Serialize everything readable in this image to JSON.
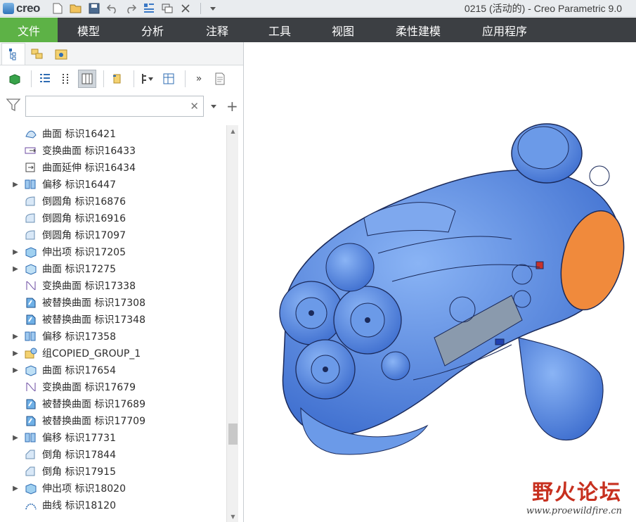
{
  "app": {
    "logo_text": "creo",
    "window_title": "0215 (活动的) - Creo Parametric 9.0"
  },
  "quick_access": [
    "new-icon",
    "open-icon",
    "save-icon",
    "undo-icon",
    "redo-icon",
    "regenerate-icon",
    "windows-icon",
    "close-icon",
    "customize-icon"
  ],
  "ribbon": {
    "tabs": [
      "文件",
      "模型",
      "分析",
      "注释",
      "工具",
      "视图",
      "柔性建模",
      "应用程序"
    ],
    "active_index": 0,
    "colors": {
      "bar": "#3c3f43",
      "active": "#5db246"
    }
  },
  "navigator": {
    "tabs": [
      "model-tree-icon",
      "layer-tree-icon",
      "favorites-icon"
    ],
    "filter": {
      "value": "",
      "placeholder": ""
    },
    "tree_items": [
      {
        "label": "曲面 标识16421",
        "icon": "surface-icon",
        "expandable": false
      },
      {
        "label": "变换曲面 标识16433",
        "icon": "transform-surface-icon",
        "expandable": false
      },
      {
        "label": "曲面延伸 标识16434",
        "icon": "surface-extend-icon",
        "expandable": false
      },
      {
        "label": "偏移 标识16447",
        "icon": "offset-icon",
        "expandable": true
      },
      {
        "label": "倒圆角 标识16876",
        "icon": "round-icon",
        "expandable": false
      },
      {
        "label": "倒圆角 标识16916",
        "icon": "round-icon",
        "expandable": false
      },
      {
        "label": "倒圆角 标识17097",
        "icon": "round-icon",
        "expandable": false
      },
      {
        "label": "伸出项 标识17205",
        "icon": "protrusion-icon",
        "expandable": true
      },
      {
        "label": "曲面 标识17275",
        "icon": "surface-solid-icon",
        "expandable": true
      },
      {
        "label": "变换曲面 标识17338",
        "icon": "transform-surface-2-icon",
        "expandable": false
      },
      {
        "label": "被替换曲面 标识17308",
        "icon": "replaced-surface-icon",
        "expandable": false
      },
      {
        "label": "被替换曲面 标识17348",
        "icon": "replaced-surface-icon",
        "expandable": false
      },
      {
        "label": "偏移 标识17358",
        "icon": "offset-icon",
        "expandable": true
      },
      {
        "label": "组COPIED_GROUP_1",
        "icon": "group-icon",
        "expandable": true
      },
      {
        "label": "曲面 标识17654",
        "icon": "surface-solid-icon",
        "expandable": true
      },
      {
        "label": "变换曲面 标识17679",
        "icon": "transform-surface-2-icon",
        "expandable": false
      },
      {
        "label": "被替换曲面 标识17689",
        "icon": "replaced-surface-icon",
        "expandable": false
      },
      {
        "label": "被替换曲面 标识17709",
        "icon": "replaced-surface-icon",
        "expandable": false
      },
      {
        "label": "偏移 标识17731",
        "icon": "offset-icon",
        "expandable": true
      },
      {
        "label": "倒角 标识17844",
        "icon": "chamfer-icon",
        "expandable": false
      },
      {
        "label": "倒角 标识17915",
        "icon": "chamfer-icon",
        "expandable": false
      },
      {
        "label": "伸出项 标识18020",
        "icon": "protrusion-icon",
        "expandable": true
      },
      {
        "label": "曲线 标识18120",
        "icon": "curve-icon",
        "expandable": false
      }
    ]
  },
  "viewport": {
    "model_colors": {
      "body": "#5b8fe6",
      "accent": "#f08a3c",
      "dark": "#1c2a55"
    }
  },
  "watermark": {
    "main": "野火论坛",
    "url": "www.proewildfire.cn"
  }
}
